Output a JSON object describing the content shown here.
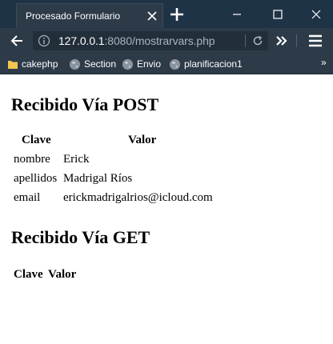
{
  "browser": {
    "tab_title": "Procesado Formulario",
    "url": {
      "host": "127.0.0.1",
      "rest": ":8080/mostrarvars.php"
    },
    "bookmarks": [
      "cakephp",
      "Section",
      "Envio",
      "planificacion1"
    ],
    "more_bookmarks": "»"
  },
  "post_section": {
    "heading": "Recibido Vía POST",
    "columns": [
      "Clave",
      "Valor"
    ],
    "rows": [
      {
        "key": "nombre",
        "value": "Erick"
      },
      {
        "key": "apellidos",
        "value": "Madrigal Ríos"
      },
      {
        "key": "email",
        "value": "erickmadrigalrios@icloud.com"
      }
    ]
  },
  "get_section": {
    "heading": "Recibido Vía GET",
    "columns": [
      "Clave",
      "Valor"
    ]
  },
  "colors": {
    "titlebar": "#1f3347",
    "toolbar": "#2d3b49",
    "url_field": "#222e3a"
  }
}
